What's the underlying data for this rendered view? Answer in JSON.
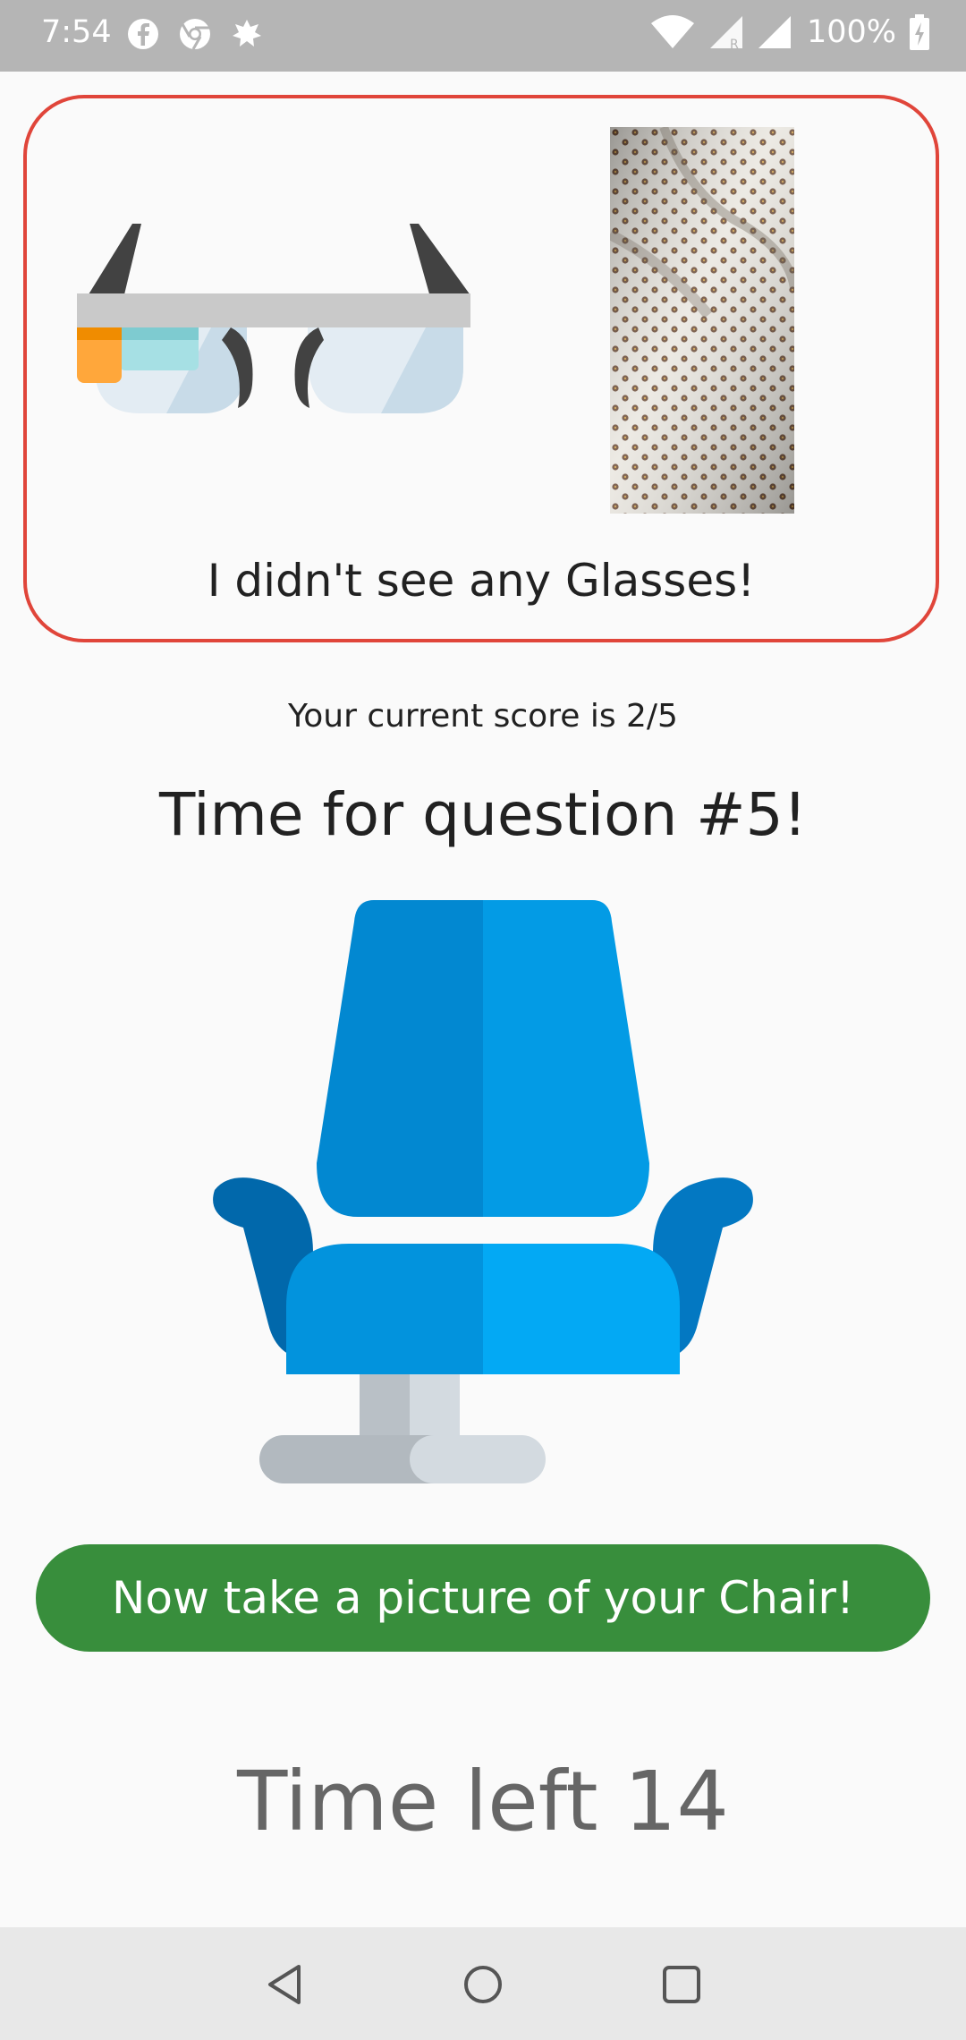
{
  "status_bar": {
    "time": "7:54",
    "battery": "100%",
    "notification_icons": [
      "facebook-icon",
      "chrome-icon",
      "notification-icon"
    ],
    "system_icons": [
      "wifi-icon",
      "signal-roaming-icon",
      "signal-icon",
      "battery-charging-icon"
    ]
  },
  "result_card": {
    "message": "I didn't see any Glasses!",
    "border_color": "#e0453a",
    "target_icon": "smart-glasses-icon",
    "captured_photo": "patterned-fabric-photo"
  },
  "score_text": "Your current score is 2/5",
  "question_text": "Time for question #5!",
  "question_icon": "chair-icon",
  "action_button": {
    "label": "Now take a picture of your Chair!",
    "color": "#388e3c"
  },
  "timer_text": "Time left 14",
  "nav_bar": [
    "back-icon",
    "home-icon",
    "recents-icon"
  ]
}
